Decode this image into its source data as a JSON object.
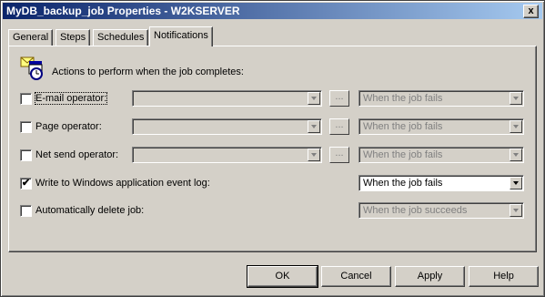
{
  "window": {
    "title": "MyDB_backup_job Properties - W2KSERVER",
    "close_glyph": "x"
  },
  "tabs": [
    {
      "label": "General"
    },
    {
      "label": "Steps"
    },
    {
      "label": "Schedules"
    },
    {
      "label": "Notifications",
      "active": true
    }
  ],
  "header": {
    "text": "Actions to perform when the job completes:"
  },
  "rows": [
    {
      "label": "E-mail operator:",
      "checked": false,
      "checkmark": "",
      "operator_value": "",
      "ellipsis": "...",
      "condition": "When the job fails",
      "enabled": false
    },
    {
      "label": "Page operator:",
      "checked": false,
      "checkmark": "",
      "operator_value": "",
      "ellipsis": "...",
      "condition": "When the job fails",
      "enabled": false
    },
    {
      "label": "Net send operator:",
      "checked": false,
      "checkmark": "",
      "operator_value": "",
      "ellipsis": "...",
      "condition": "When the job fails",
      "enabled": false
    },
    {
      "label": "Write to Windows application event log:",
      "checked": true,
      "checkmark": "✔",
      "condition": "When the job fails",
      "enabled": true
    },
    {
      "label": "Automatically delete job:",
      "checked": false,
      "checkmark": "",
      "condition": "When the job succeeds",
      "enabled": false
    }
  ],
  "buttons": {
    "ok": "OK",
    "cancel": "Cancel",
    "apply": "Apply",
    "help": "Help"
  },
  "icons": {
    "header": "mail-clock-icon"
  },
  "colors": {
    "titlebar_start": "#0a246a",
    "titlebar_end": "#a6caf0",
    "face": "#d4d0c8"
  }
}
